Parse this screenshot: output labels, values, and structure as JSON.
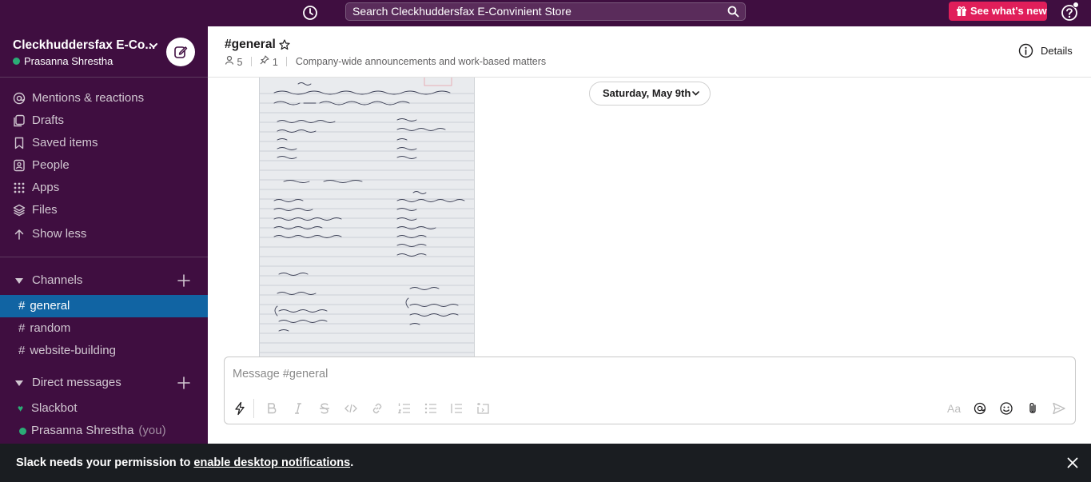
{
  "topbar": {
    "search_placeholder": "Search Cleckhuddersfax E-Convinient Store",
    "whats_new_label": "See what's new"
  },
  "workspace": {
    "name": "Cleckhuddersfax E-Co...",
    "user": "Prasanna Shrestha"
  },
  "sidebar": {
    "nav": [
      {
        "label": "Mentions & reactions",
        "icon": "at-icon"
      },
      {
        "label": "Drafts",
        "icon": "drafts-icon"
      },
      {
        "label": "Saved items",
        "icon": "bookmark-icon"
      },
      {
        "label": "People",
        "icon": "people-icon"
      },
      {
        "label": "Apps",
        "icon": "apps-grid-icon"
      },
      {
        "label": "Files",
        "icon": "files-icon"
      },
      {
        "label": "Show less",
        "icon": "arrow-up-icon"
      }
    ],
    "channels_label": "Channels",
    "channels": [
      {
        "name": "general",
        "active": true
      },
      {
        "name": "random",
        "active": false
      },
      {
        "name": "website-building",
        "active": false
      }
    ],
    "dms_label": "Direct messages",
    "dms": [
      {
        "name": "Slackbot",
        "suffix": ""
      },
      {
        "name": "Prasanna Shrestha",
        "suffix": "(you)"
      }
    ]
  },
  "channel": {
    "title": "#general",
    "members": "5",
    "pins": "1",
    "topic": "Company-wide announcements and work-based matters",
    "details_label": "Details"
  },
  "messages": {
    "date_divider": "Saturday, May 9th"
  },
  "composer": {
    "placeholder": "Message #general"
  },
  "banner": {
    "text_before": "Slack needs your permission to ",
    "link": "enable desktop notifications",
    "text_after": "."
  },
  "colors": {
    "sidebar_bg": "#3f0e40",
    "active_channel": "#1164a3",
    "whats_new": "#e01e5a",
    "presence": "#2bac76"
  }
}
